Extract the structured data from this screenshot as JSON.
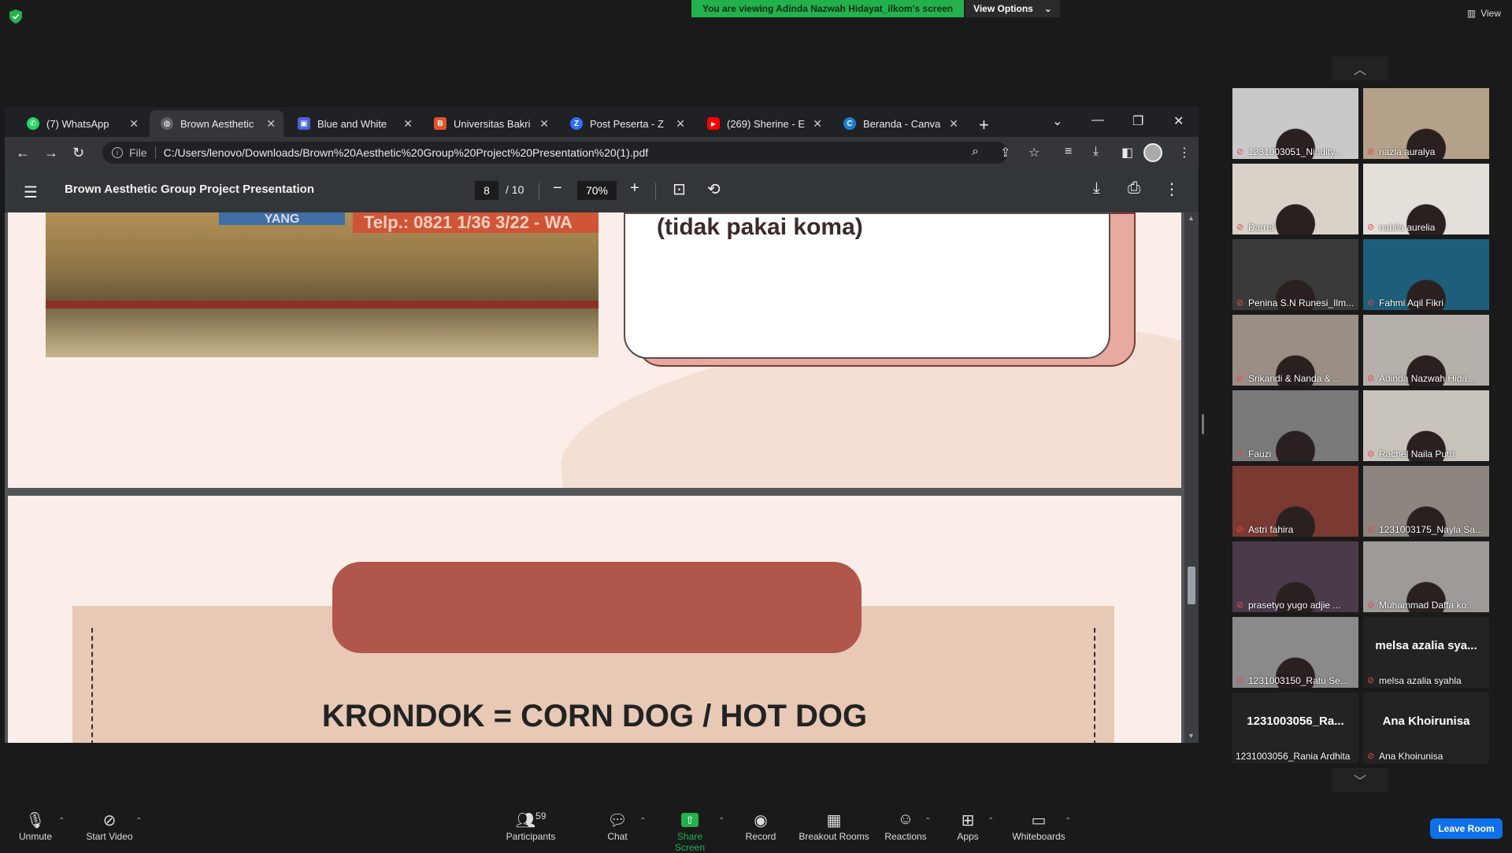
{
  "zoom_top": {
    "banner_text": "You are viewing Adinda Nazwah Hidayat_ilkom's screen",
    "view_options_label": "View Options",
    "view_label": "View"
  },
  "browser": {
    "tabs": [
      {
        "label": "(7) WhatsApp",
        "color": "#25d366",
        "glyph": "✆"
      },
      {
        "label": "Brown Aesthetic",
        "color": "#5f6368",
        "glyph": "◍"
      },
      {
        "label": "Blue and White",
        "color": "#4a63d8",
        "glyph": "▣"
      },
      {
        "label": "Universitas Bakri",
        "color": "#e0542a",
        "glyph": "B"
      },
      {
        "label": "Post Peserta - Z",
        "color": "#2d6ff7",
        "glyph": "Z"
      },
      {
        "label": "(269) Sherine - E",
        "color": "#ff0000",
        "glyph": "▶"
      },
      {
        "label": "Beranda - Canva",
        "color": "#1a7fd6",
        "glyph": "C"
      }
    ],
    "url_prefix": "File",
    "url": "C:/Users/lenovo/Downloads/Brown%20Aesthetic%20Group%20Project%20Presentation%20(1).pdf"
  },
  "pdf": {
    "title": "Brown Aesthetic Group Project Presentation",
    "page_current": "8",
    "page_total": "/ 10",
    "zoom": "70%",
    "page8_card_text": "(tidak pakai koma)",
    "page8_sign_text": "Telp.: 0821 1/36 3/22 - WA",
    "page8_sign2_text": "YANG",
    "page9_text": "KRONDOK = CORN DOG / HOT DOG"
  },
  "participants": [
    {
      "name": "1231003051_Nindity...",
      "muted": true,
      "video": true,
      "tone": "#c9c9c9"
    },
    {
      "name": "nazla auralya",
      "muted": true,
      "video": true,
      "tone": "#b5a08a"
    },
    {
      "name": "Darrel",
      "muted": true,
      "video": true,
      "tone": "#d8d2c8"
    },
    {
      "name": "nabila aurelia",
      "muted": true,
      "video": true,
      "tone": "#e3e0da"
    },
    {
      "name": "Penina S.N Runesi_Ilm...",
      "muted": true,
      "video": true,
      "tone": "#3a3a3a"
    },
    {
      "name": "Fahmi Aqil Fikri",
      "muted": true,
      "video": true,
      "tone": "#1e5e7a"
    },
    {
      "name": "Srikandi & Nanda & ...",
      "muted": true,
      "video": true,
      "tone": "#9a8e86"
    },
    {
      "name": "Adinda Nazwah Hida...",
      "muted": true,
      "video": true,
      "tone": "#b6b0aa"
    },
    {
      "name": "Fauzi",
      "muted": true,
      "video": true,
      "tone": "#7a7a7a"
    },
    {
      "name": "Rachel Naila Putri",
      "muted": true,
      "video": true,
      "tone": "#c8c4bc"
    },
    {
      "name": "Astri fahira",
      "muted": true,
      "video": true,
      "tone": "#7a3a32"
    },
    {
      "name": "1231003175_Nayla Sa...",
      "muted": true,
      "video": true,
      "tone": "#8d8680"
    },
    {
      "name": "prasetyo yugo adjie ...",
      "muted": true,
      "video": true,
      "tone": "#4a3a4a"
    },
    {
      "name": "Muhammad Daffa ko...",
      "muted": true,
      "video": true,
      "tone": "#9e9a98"
    },
    {
      "name": "1231003150_Ratu Se...",
      "muted": true,
      "video": true,
      "tone": "#8a8a8a"
    },
    {
      "name": "melsa azalia syahla",
      "muted": true,
      "video": false,
      "big": "melsa azalia sya...",
      "tone": "#232323"
    },
    {
      "name": "1231003056_Rania Ardhita",
      "muted": false,
      "video": false,
      "big": "1231003056_Ra...",
      "tone": "#232323"
    },
    {
      "name": "Ana Khoirunisa",
      "muted": true,
      "video": false,
      "big": "Ana Khoirunisa",
      "tone": "#232323"
    }
  ],
  "toolbar": {
    "unmute": "Unmute",
    "start_video": "Start Video",
    "participants": "Participants",
    "participants_count": "59",
    "chat": "Chat",
    "share_screen": "Share Screen",
    "record": "Record",
    "breakout_rooms": "Breakout Rooms",
    "reactions": "Reactions",
    "apps": "Apps",
    "whiteboards": "Whiteboards",
    "leave": "Leave Room"
  },
  "colors": {
    "share_green": "#23b14d",
    "leave_blue": "#0e71eb",
    "mute_red": "#e54848"
  }
}
